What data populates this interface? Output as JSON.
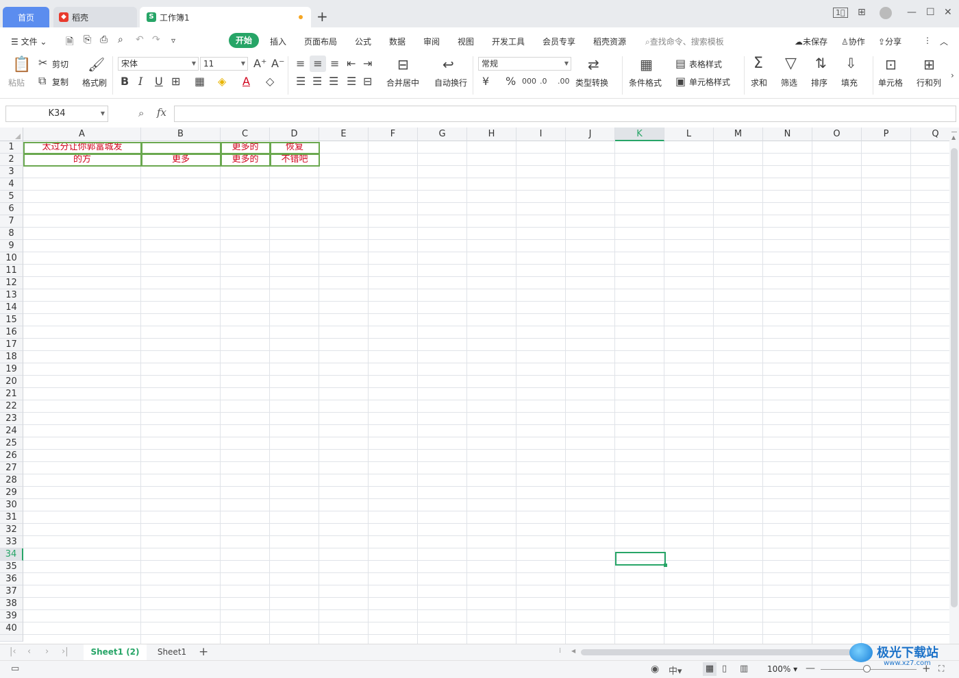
{
  "tabs": {
    "home": "首页",
    "daoke": "稻壳",
    "workbook": "工作簿1"
  },
  "menu": {
    "file": "文件",
    "start": "开始",
    "insert": "插入",
    "layout": "页面布局",
    "formula": "公式",
    "data": "数据",
    "review": "审阅",
    "view": "视图",
    "dev": "开发工具",
    "member": "会员专享",
    "resource": "稻壳资源",
    "search": "查找命令、搜索模板",
    "unsaved": "未保存",
    "collab": "协作",
    "share": "分享"
  },
  "ribbon": {
    "paste": "粘贴",
    "cut": "剪切",
    "copy": "复制",
    "format_painter": "格式刷",
    "font": "宋体",
    "size": "11",
    "merge": "合并居中",
    "wrap": "自动换行",
    "number_format": "常规",
    "convert": "类型转换",
    "cond_format": "条件格式",
    "table_style": "表格样式",
    "cell_style": "单元格样式",
    "sum": "求和",
    "filter": "筛选",
    "sort": "排序",
    "fill": "填充",
    "cell": "单元格",
    "rowcol": "行和列"
  },
  "formula": {
    "namebox": "K34",
    "fx": "fx",
    "value": ""
  },
  "columns": [
    "A",
    "B",
    "C",
    "D",
    "E",
    "F",
    "G",
    "H",
    "I",
    "J",
    "K",
    "L",
    "M",
    "N",
    "O",
    "P",
    "Q"
  ],
  "rows": [
    "1",
    "2",
    "3",
    "4",
    "5",
    "6",
    "7",
    "8",
    "9",
    "10",
    "11",
    "12",
    "13",
    "14",
    "15",
    "16",
    "17",
    "18",
    "19",
    "20",
    "21",
    "22",
    "23",
    "24",
    "25",
    "26",
    "27",
    "28",
    "29",
    "30",
    "31",
    "32",
    "33",
    "34",
    "35",
    "36",
    "37",
    "38",
    "39",
    "40"
  ],
  "cells": {
    "A1": "太过分让你郭富城发",
    "C1": "更多的",
    "D1": "恢复",
    "A2": "的方",
    "B2": "更多",
    "C2": "更多的",
    "D2": "不错吧"
  },
  "sheets": [
    "Sheet1 (2)",
    "Sheet1"
  ],
  "status": {
    "zoom": "100%"
  },
  "watermark": {
    "text": "极光下载站",
    "url": "www.xz7.com"
  },
  "colors": {
    "accent": "#27a567",
    "cell_text": "#d0021b",
    "border": "#6aa84f"
  }
}
